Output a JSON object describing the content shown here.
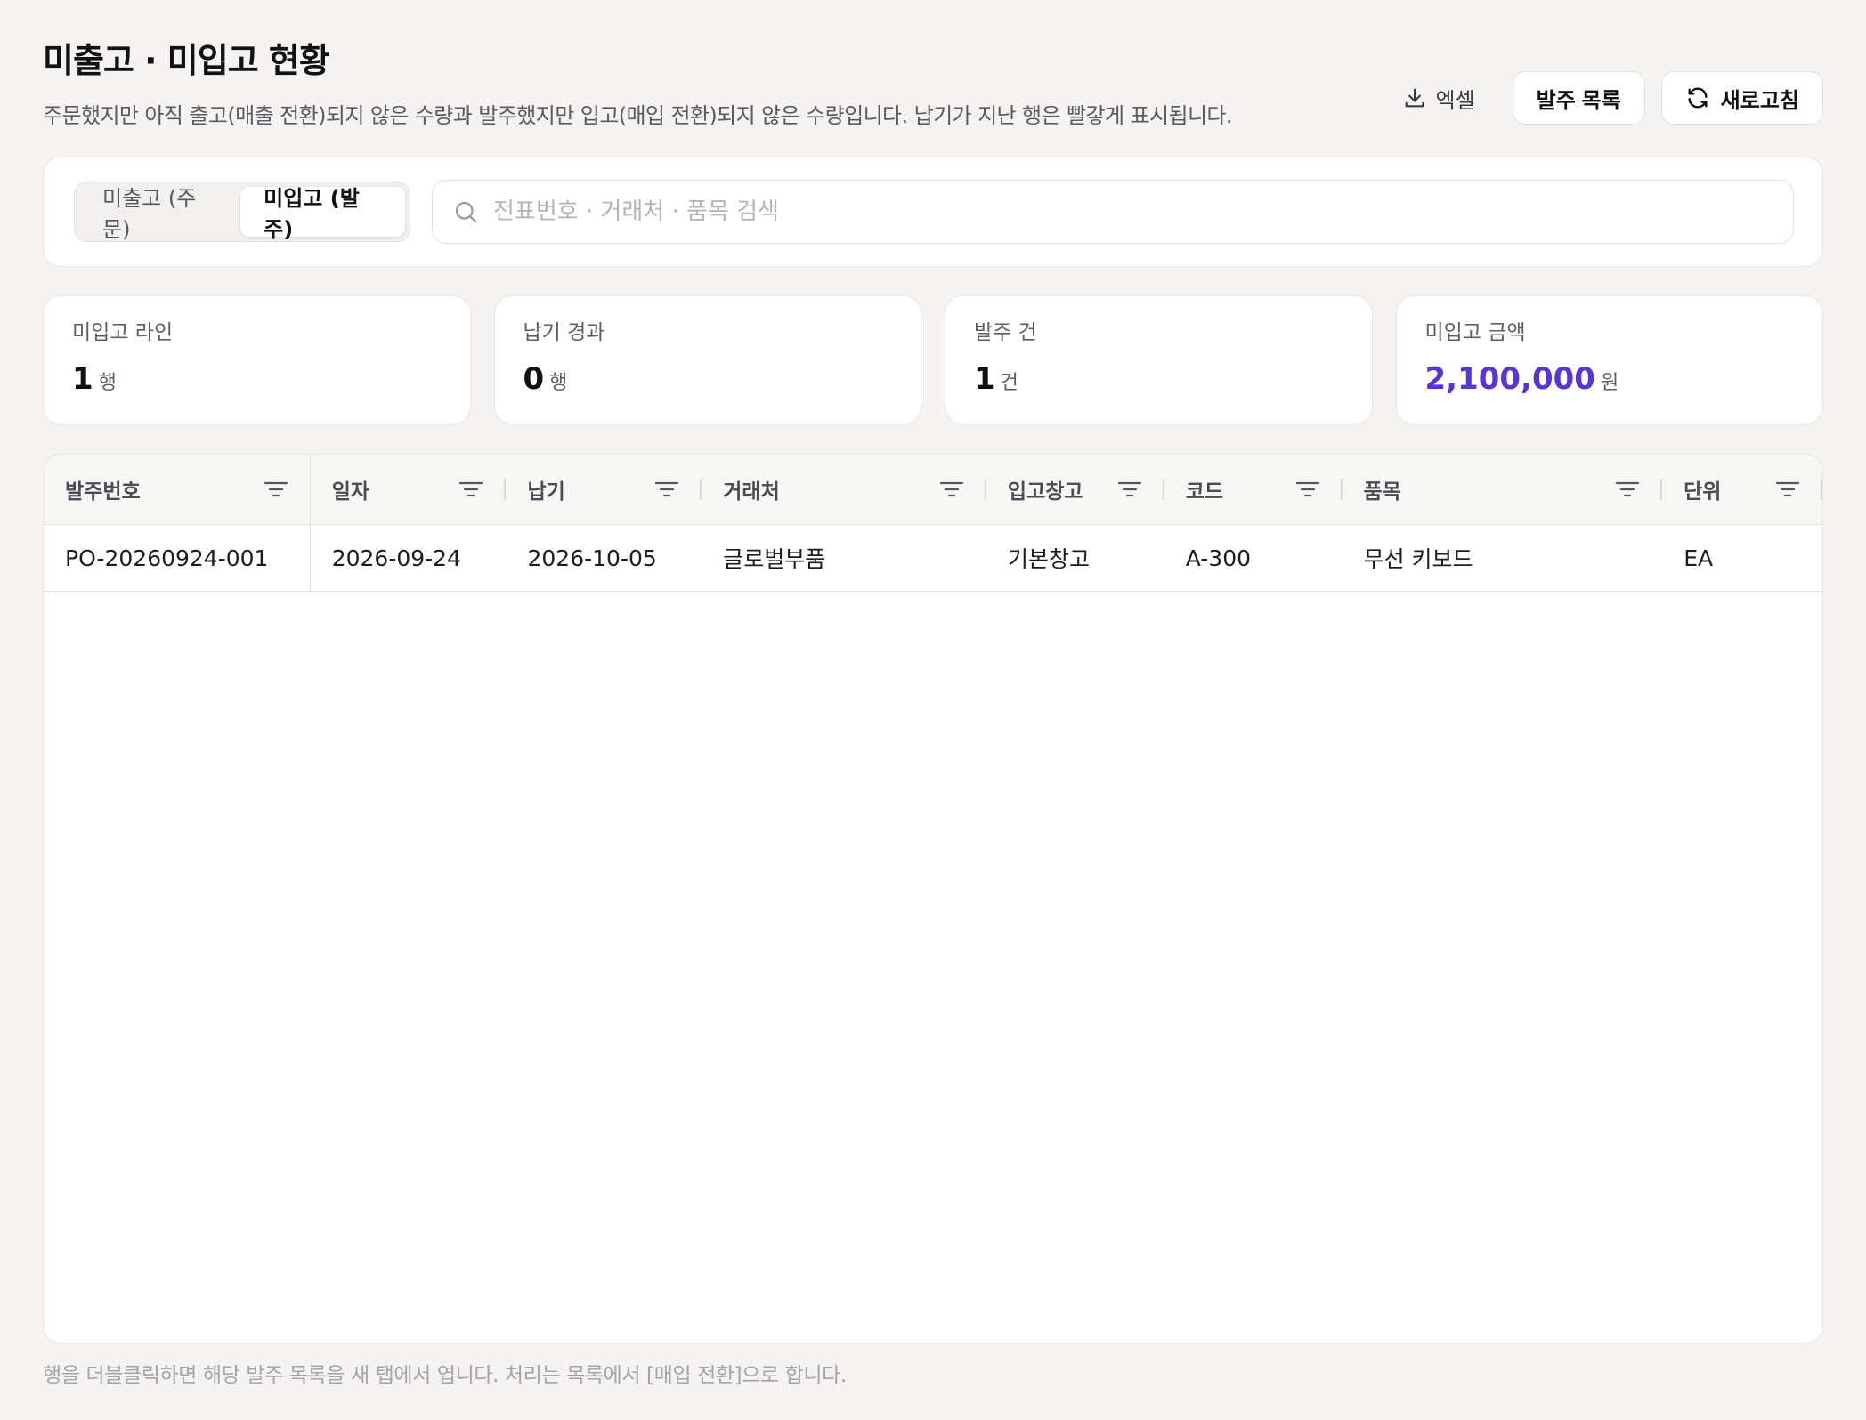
{
  "header": {
    "title": "미출고 · 미입고 현황",
    "description": "주문했지만 아직 출고(매출 전환)되지 않은 수량과 발주했지만 입고(매입 전환)되지 않은 수량입니다. 납기가 지난 행은 빨갛게 표시됩니다.",
    "actions": {
      "excel_label": "엑셀",
      "po_list_label": "발주 목록",
      "refresh_label": "새로고침"
    }
  },
  "filters": {
    "segments": [
      {
        "label": "미출고 (주문)",
        "active": false
      },
      {
        "label": "미입고 (발주)",
        "active": true
      }
    ],
    "search_placeholder": "전표번호 · 거래처 · 품목 검색",
    "search_value": ""
  },
  "stats": [
    {
      "label": "미입고 라인",
      "value": "1",
      "unit": "행"
    },
    {
      "label": "납기 경과",
      "value": "0",
      "unit": "행"
    },
    {
      "label": "발주 건",
      "value": "1",
      "unit": "건"
    },
    {
      "label": "미입고 금액",
      "value": "2,100,000",
      "unit": "원"
    }
  ],
  "grid": {
    "columns": [
      "발주번호",
      "일자",
      "납기",
      "거래처",
      "입고창고",
      "코드",
      "품목",
      "단위"
    ],
    "rows": [
      [
        "PO-20260924-001",
        "2026-09-24",
        "2026-10-05",
        "글로벌부품",
        "기본창고",
        "A-300",
        "무선 키보드",
        "EA"
      ]
    ]
  },
  "footer_note": "행을 더블클릭하면 해당 발주 목록을 새 탭에서 엽니다. 처리는 목록에서 [매입 전환]으로 합니다.",
  "colors": {
    "background": "#f4f3f1",
    "accent": "#5a35d6",
    "card": "#ffffff"
  },
  "icons": [
    "download-icon",
    "refresh-icon",
    "search-icon",
    "filter-icon"
  ]
}
